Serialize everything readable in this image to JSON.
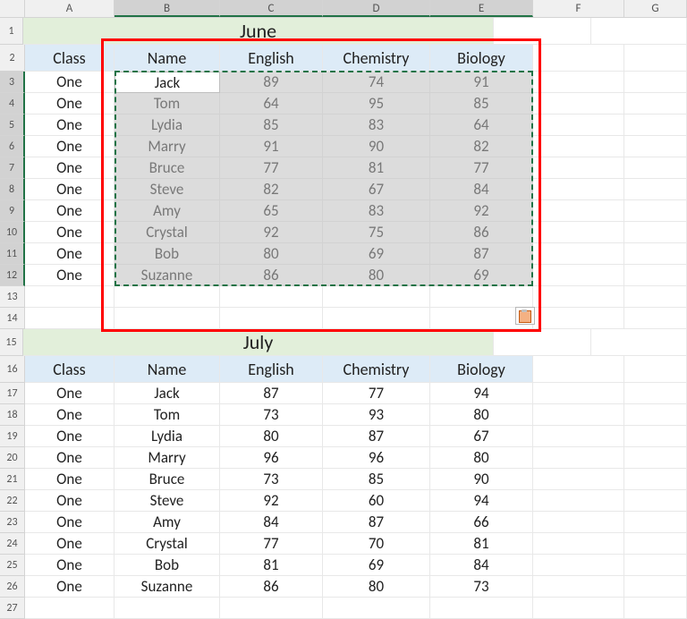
{
  "columns": [
    "A",
    "B",
    "C",
    "D",
    "E",
    "F",
    "G"
  ],
  "selected_cols": [
    "B",
    "C",
    "D",
    "E"
  ],
  "selected_rows": [
    3,
    4,
    5,
    6,
    7,
    8,
    9,
    10,
    11,
    12
  ],
  "active_cell_value": "Jack",
  "june": {
    "title": "June",
    "headers": {
      "class": "Class",
      "name": "Name",
      "english": "English",
      "chemistry": "Chemistry",
      "biology": "Biology"
    },
    "rows": [
      {
        "class": "One",
        "name": "Jack",
        "english": "89",
        "chemistry": "74",
        "biology": "91"
      },
      {
        "class": "One",
        "name": "Tom",
        "english": "64",
        "chemistry": "95",
        "biology": "85"
      },
      {
        "class": "One",
        "name": "Lydia",
        "english": "85",
        "chemistry": "83",
        "biology": "64"
      },
      {
        "class": "One",
        "name": "Marry",
        "english": "91",
        "chemistry": "90",
        "biology": "82"
      },
      {
        "class": "One",
        "name": "Bruce",
        "english": "77",
        "chemistry": "81",
        "biology": "77"
      },
      {
        "class": "One",
        "name": "Steve",
        "english": "82",
        "chemistry": "67",
        "biology": "84"
      },
      {
        "class": "One",
        "name": "Amy",
        "english": "65",
        "chemistry": "83",
        "biology": "92"
      },
      {
        "class": "One",
        "name": "Crystal",
        "english": "92",
        "chemistry": "75",
        "biology": "86"
      },
      {
        "class": "One",
        "name": "Bob",
        "english": "80",
        "chemistry": "69",
        "biology": "87"
      },
      {
        "class": "One",
        "name": "Suzanne",
        "english": "86",
        "chemistry": "80",
        "biology": "69"
      }
    ]
  },
  "july": {
    "title": "July",
    "headers": {
      "class": "Class",
      "name": "Name",
      "english": "English",
      "chemistry": "Chemistry",
      "biology": "Biology"
    },
    "rows": [
      {
        "class": "One",
        "name": "Jack",
        "english": "87",
        "chemistry": "77",
        "biology": "94"
      },
      {
        "class": "One",
        "name": "Tom",
        "english": "73",
        "chemistry": "93",
        "biology": "80"
      },
      {
        "class": "One",
        "name": "Lydia",
        "english": "80",
        "chemistry": "87",
        "biology": "67"
      },
      {
        "class": "One",
        "name": "Marry",
        "english": "96",
        "chemistry": "96",
        "biology": "80"
      },
      {
        "class": "One",
        "name": "Bruce",
        "english": "73",
        "chemistry": "85",
        "biology": "90"
      },
      {
        "class": "One",
        "name": "Steve",
        "english": "92",
        "chemistry": "60",
        "biology": "94"
      },
      {
        "class": "One",
        "name": "Amy",
        "english": "84",
        "chemistry": "87",
        "biology": "66"
      },
      {
        "class": "One",
        "name": "Crystal",
        "english": "77",
        "chemistry": "70",
        "biology": "81"
      },
      {
        "class": "One",
        "name": "Bob",
        "english": "81",
        "chemistry": "69",
        "biology": "84"
      },
      {
        "class": "One",
        "name": "Suzanne",
        "english": "86",
        "chemistry": "80",
        "biology": "73"
      }
    ]
  }
}
